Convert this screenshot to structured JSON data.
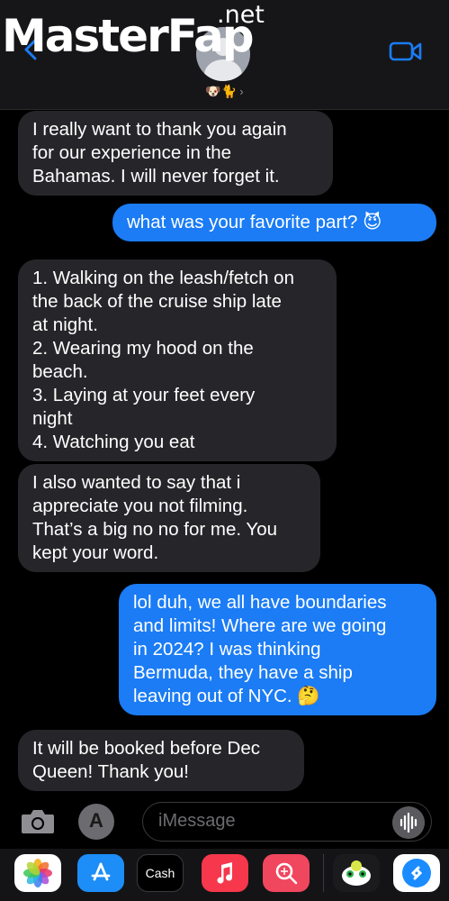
{
  "watermark": {
    "brand_main": "MasterFap",
    "brand_suffix": ".net"
  },
  "header": {
    "contact_name": "🐶🐈",
    "chevron": "›",
    "back_icon": "chevron-left-icon",
    "video_icon": "video-camera-icon"
  },
  "messages": [
    {
      "dir": "in",
      "lines": [
        "I really want to thank you again",
        "for our experience in the",
        "Bahamas. I will never forget it."
      ]
    },
    {
      "dir": "out",
      "lines": [
        "what was your favorite part? 😈"
      ]
    },
    {
      "dir": "in",
      "lines": [
        "1. Walking on the leash/fetch on",
        "the back of the cruise ship late",
        "at night.",
        "2. Wearing my hood on the",
        "beach.",
        "3. Laying at your feet every",
        "night",
        "4. Watching you eat"
      ]
    },
    {
      "dir": "in",
      "lines": [
        "I also wanted to say that i",
        "appreciate you not filming.",
        "That’s a big no no for me. You",
        "kept your word."
      ]
    },
    {
      "dir": "out",
      "lines": [
        "lol duh, we all have boundaries",
        "and limits! Where are we going",
        "in 2024? I was thinking",
        "Bermuda, they have a ship",
        "leaving out of NYC. 🤔"
      ]
    },
    {
      "dir": "in",
      "lines": [
        "It will be booked before Dec",
        "Queen! Thank you!"
      ]
    }
  ],
  "input": {
    "placeholder": "iMessage",
    "camera_icon": "camera-icon",
    "apps_icon": "app-store-icon",
    "mic_icon": "audio-waveform-icon"
  },
  "drawer": {
    "apps": [
      {
        "name": "photos-app-icon",
        "label": ""
      },
      {
        "name": "app-store-app-icon",
        "label": ""
      },
      {
        "name": "apple-cash-app-icon",
        "label": "Cash"
      },
      {
        "name": "music-app-icon",
        "label": ""
      },
      {
        "name": "search-images-app-icon",
        "label": ""
      },
      {
        "name": "game-app-icon",
        "label": ""
      },
      {
        "name": "shazam-app-icon",
        "label": ""
      }
    ]
  },
  "colors": {
    "incoming_bubble": "#26262a",
    "outgoing_bubble": "#1b7cf5",
    "accent": "#1b7cf5",
    "background": "#000000"
  }
}
